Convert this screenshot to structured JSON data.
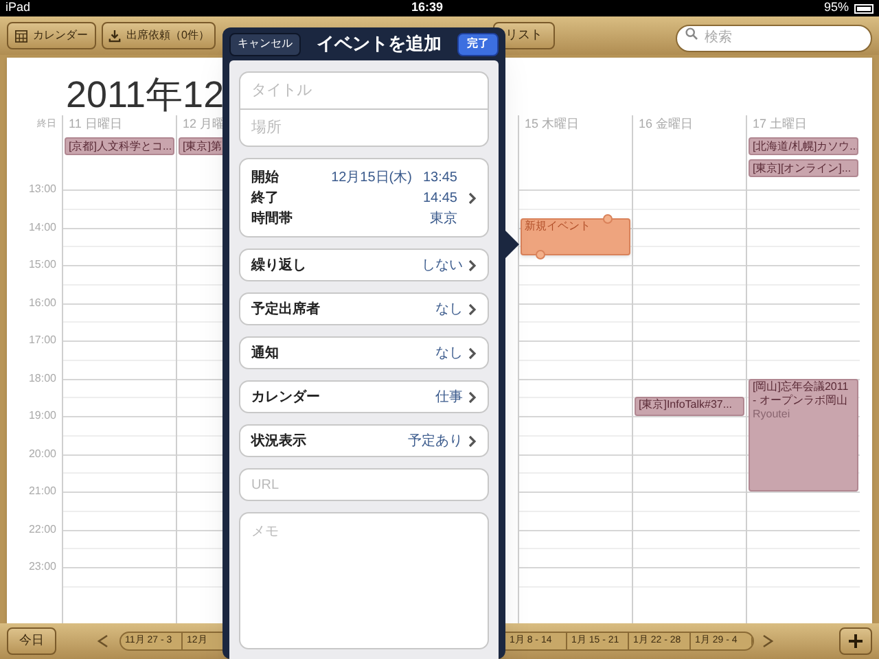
{
  "status_bar": {
    "device": "iPad",
    "time": "16:39",
    "battery": "95%"
  },
  "toolbar": {
    "calendars_button": "カレンダー",
    "invitations_button": "出席依頼（0件）",
    "list_tab": "リスト",
    "search": {
      "placeholder": "検索"
    }
  },
  "calendar": {
    "title": "2011年12",
    "all_day_label": "終日",
    "hours": [
      "13:00",
      "14:00",
      "15:00",
      "16:00",
      "17:00",
      "18:00",
      "19:00",
      "20:00",
      "21:00",
      "22:00",
      "23:00"
    ],
    "left_days": [
      {
        "label": "11 日曜日",
        "all_day": [
          "[京都]人文科学とコ..."
        ]
      },
      {
        "label": "12 月曜",
        "all_day": [
          "[東京]第"
        ]
      }
    ],
    "right_days": [
      {
        "label": "15 木曜日",
        "events": [
          {
            "kind": "new",
            "title": "新規イベント"
          }
        ]
      },
      {
        "label": "16 金曜日",
        "events": [
          {
            "kind": "normal",
            "title": "[東京]InfoTalk#37..."
          }
        ]
      },
      {
        "label": "17 土曜日",
        "all_day": [
          "[北海道/札幌]カソウ...",
          "[東京][オンライン]..."
        ],
        "events": [
          {
            "kind": "normal",
            "title": "[岡山]忘年会議2011 - オープンラボ岡山",
            "location": "Ryoutei"
          }
        ]
      }
    ]
  },
  "popover": {
    "title": "イベントを追加",
    "cancel_button": "キャンセル",
    "done_button": "完了",
    "title_field": {
      "placeholder": "タイトル"
    },
    "location_field": {
      "placeholder": "場所"
    },
    "time_rows": [
      {
        "label": "開始",
        "date": "12月15日(木)",
        "value": "13:45"
      },
      {
        "label": "終了",
        "value": "14:45"
      },
      {
        "label": "時間帯",
        "value": "東京"
      }
    ],
    "rows": [
      {
        "label": "繰り返し",
        "value": "しない"
      },
      {
        "label": "予定出席者",
        "value": "なし"
      },
      {
        "label": "通知",
        "value": "なし"
      },
      {
        "label": "カレンダー",
        "value": "仕事"
      },
      {
        "label": "状況表示",
        "value": "予定あり"
      }
    ],
    "url_field": {
      "placeholder": "URL"
    },
    "notes_field": {
      "placeholder": "メモ"
    }
  },
  "bottom_bar": {
    "today_button": "今日",
    "weeks": [
      {
        "label": "11月 27 - 3"
      },
      {
        "label": "12月"
      },
      {
        "label": "1月 8 - 14"
      },
      {
        "label": "1月 15 - 21"
      },
      {
        "label": "1月 22 - 28"
      },
      {
        "label": "1月 29 - 4"
      }
    ]
  }
}
